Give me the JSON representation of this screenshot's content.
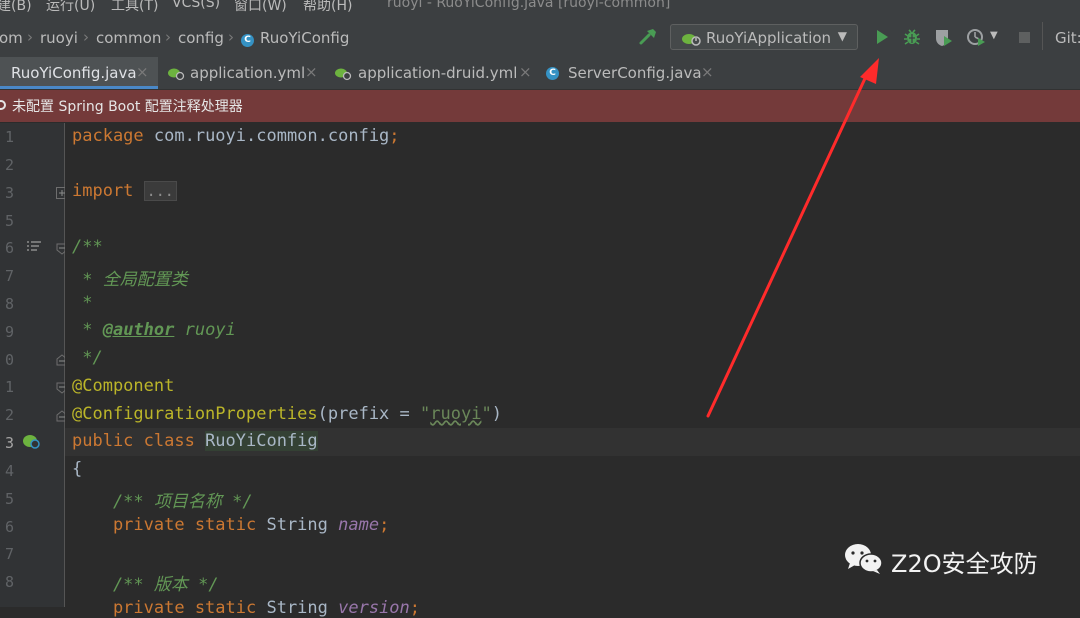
{
  "window": {
    "title": "ruoyi - RuoYiConfig.java [ruoyi-common]"
  },
  "menu": [
    {
      "label": "建(B)"
    },
    {
      "label": "运行(U)"
    },
    {
      "label": "工具(T)"
    },
    {
      "label": "VCS(S)"
    },
    {
      "label": "窗口(W)"
    },
    {
      "label": "帮助(H)"
    }
  ],
  "breadcrumb": [
    "om",
    "ruoyi",
    "common",
    "config",
    "RuoYiConfig"
  ],
  "run_config": {
    "label": "RuoYiApplication"
  },
  "git_label": "Git:",
  "tabs": [
    {
      "label": "RuoYiConfig.java",
      "icon": "class-icon",
      "close": "×"
    },
    {
      "label": "application.yml",
      "icon": "spring-config-icon",
      "close": "×"
    },
    {
      "label": "application-druid.yml",
      "icon": "spring-config-icon",
      "close": "×"
    },
    {
      "label": "ServerConfig.java",
      "icon": "class-icon",
      "close": "×"
    }
  ],
  "banner": {
    "text": "未配置 Spring Boot 配置注释处理器"
  },
  "line_numbers": [
    "1",
    "2",
    "3",
    "5",
    "6",
    "7",
    "8",
    "9",
    "0",
    "1",
    "2",
    "3",
    "4",
    "5",
    "6",
    "7",
    "8"
  ],
  "code": {
    "package_kw": "package",
    "package_name": " com.ruoyi.common.config",
    "semicolon": ";",
    "import_kw": "import",
    "import_fold": "...",
    "doc_open": "/**",
    "doc_line1_star": " * ",
    "doc_line1_text": "全局配置类",
    "doc_line2": " *",
    "doc_line3_star": " * ",
    "doc_author_tag": "@author",
    "doc_author_val": " ruoyi",
    "doc_close": " */",
    "ann_component": "@Component",
    "ann_props": "@ConfigurationProperties",
    "ann_props_open": "(prefix = ",
    "ann_props_value_q1": "\"",
    "ann_props_value": "ruoyi",
    "ann_props_value_q2": "\"",
    "ann_props_close": ")",
    "class_kw": "public class ",
    "class_name": "RuoYiConfig",
    "brace_open": "{",
    "comment_name": "    /** 项目名称 */",
    "field_mods": "    private static ",
    "field_type": "String ",
    "field_name": "name",
    "comment_version": "    /** 版本 */",
    "field2_mods": "    private static ",
    "field2_type": "String ",
    "field2_name": "version",
    "field2_end": ";"
  },
  "watermark": {
    "text": "Z2O安全攻防"
  },
  "colors": {
    "keyword": "#cc7832",
    "annotation": "#bbb529",
    "doc_comment": "#629755",
    "string": "#6a8759",
    "field": "#9876aa",
    "banner_bg": "#743a3a",
    "arrow": "#ff2b2b",
    "run_green": "#499c54"
  }
}
